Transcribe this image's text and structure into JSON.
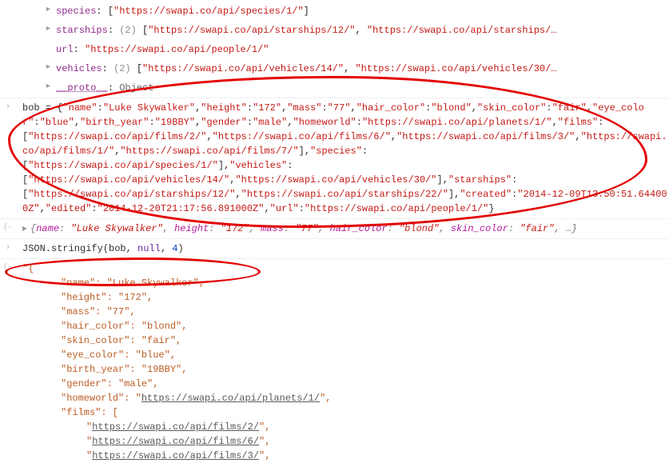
{
  "top_props": {
    "species": {
      "label": "species",
      "items": [
        "https://swapi.co/api/species/1/"
      ]
    },
    "starships": {
      "label": "starships",
      "count": 2,
      "items": [
        "https://swapi.co/api/starships/12/",
        "https://swapi.co/api/starships/…"
      ]
    },
    "url": {
      "label": "url",
      "value": "https://swapi.co/api/people/1/"
    },
    "vehicles": {
      "label": "vehicles",
      "count": 2,
      "items": [
        "https://swapi.co/api/vehicles/14/",
        "https://swapi.co/api/vehicles/30/…"
      ]
    },
    "proto": {
      "label": "__proto__",
      "value": "Object"
    }
  },
  "bob_input": {
    "var": "bob",
    "assign": " = {",
    "name_key": "\"name\"",
    "name_val": "\"Luke Skywalker\"",
    "height_key": "\"height\"",
    "height_val": "\"172\"",
    "mass_key": "\"mass\"",
    "mass_val": "\"77\"",
    "hair_key": "\"hair_color\"",
    "hair_val": "\"blond\"",
    "skin_key": "\"skin_color\"",
    "skin_val": "\"fair\"",
    "eye_key": "\"eye_color\"",
    "eye_val": "\"blue\"",
    "birth_key": "\"birth_year\"",
    "birth_val": "\"19BBY\"",
    "gender_key": "\"gender\"",
    "gender_val": "\"male\"",
    "home_key": "\"homeworld\"",
    "home_val": "\"https://swapi.co/api/planets/1/\"",
    "films_key": "\"films\"",
    "films": [
      "\"https://swapi.co/api/films/2/\"",
      "\"https://swapi.co/api/films/6/\"",
      "\"https://swapi.co/api/films/3/\"",
      "\"https://swapi.co/api/films/1/\"",
      "\"https://swapi.co/api/films/7/\""
    ],
    "species_key": "\"species\"",
    "species": [
      "\"https://swapi.co/api/species/1/\""
    ],
    "vehicles_key": "\"vehicles\"",
    "vehicles": [
      "\"https://swapi.co/api/vehicles/14/\"",
      "\"https://swapi.co/api/vehicles/30/\""
    ],
    "starships_key": "\"starships\"",
    "starships": [
      "\"https://swapi.co/api/starships/12/\"",
      "\"https://swapi.co/api/starships/22/\""
    ],
    "created_key": "\"created\"",
    "created_val": "\"2014-12-09T13:50:51.644000Z\"",
    "edited_key": "\"edited\"",
    "edited_val": "\"2014-12-20T21:17:56.891000Z\"",
    "url_key": "\"url\"",
    "url_val": "\"https://swapi.co/api/people/1/\"",
    "close": "}"
  },
  "bob_preview": {
    "name_k": "name",
    "name_v": "\"Luke Skywalker\"",
    "height_k": "height",
    "height_v": "\"172\"",
    "mass_k": "mass",
    "mass_v": "\"77\"",
    "hair_k": "hair_color",
    "hair_v": "\"blond\"",
    "skin_k": "skin_color",
    "skin_v": "\"fair\"",
    "ellipsis": ", …}"
  },
  "stringify": {
    "call_prefix": "JSON.stringify(",
    "arg1": "bob",
    "arg2": "null",
    "arg3": "4",
    "close": ")"
  },
  "stringify_out": {
    "open_quote": "\"{",
    "name": "\"name\": \"Luke Skywalker\",",
    "height": "\"height\": \"172\",",
    "mass": "\"mass\": \"77\",",
    "hair": "\"hair_color\": \"blond\",",
    "skin": "\"skin_color\": \"fair\",",
    "eye": "\"eye_color\": \"blue\",",
    "birth": "\"birth_year\": \"19BBY\",",
    "gender": "\"gender\": \"male\",",
    "homeworld_k": "\"homeworld\": \"",
    "homeworld_url": "https://swapi.co/api/planets/1/",
    "homeworld_end": "\",",
    "films_k": "\"films\": [",
    "films": [
      "https://swapi.co/api/films/2/",
      "https://swapi.co/api/films/6/",
      "https://swapi.co/api/films/3/"
    ]
  }
}
